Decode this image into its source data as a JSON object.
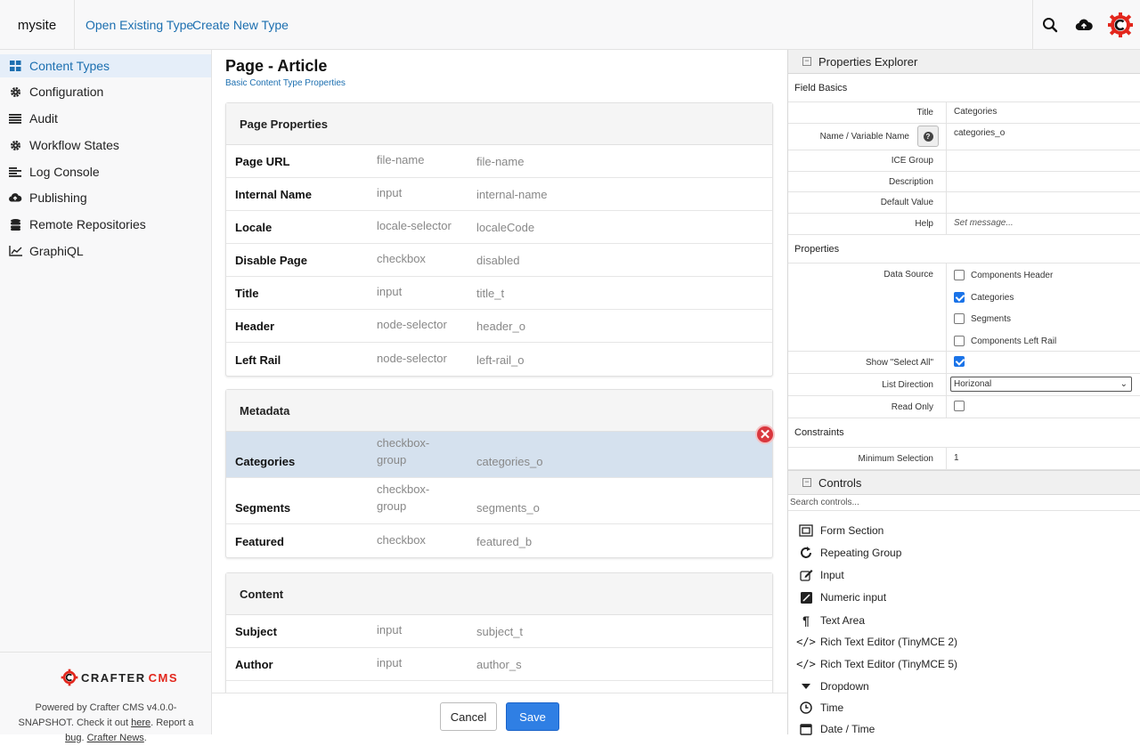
{
  "topbar": {
    "site": "mysite",
    "open_existing": "Open Existing Type",
    "create_new": "Create New Type"
  },
  "sidebar": {
    "items": [
      {
        "label": "Content Types",
        "icon": "grid-icon"
      },
      {
        "label": "Configuration",
        "icon": "gear-icon"
      },
      {
        "label": "Audit",
        "icon": "list-icon"
      },
      {
        "label": "Workflow States",
        "icon": "gear-icon"
      },
      {
        "label": "Log Console",
        "icon": "log-icon"
      },
      {
        "label": "Publishing",
        "icon": "cloud-upload-icon"
      },
      {
        "label": "Remote Repositories",
        "icon": "database-icon"
      },
      {
        "label": "GraphiQL",
        "icon": "chart-icon"
      }
    ],
    "footer": {
      "logo_crafter": "CRAFTER",
      "logo_cms": "CMS",
      "powered": "Powered by Crafter CMS v4.0.0-SNAPSHOT. Check it out ",
      "here": "here",
      "report": ". Report a ",
      "bug": "bug",
      "sep": ". ",
      "news": "Crafter News",
      "end": "."
    }
  },
  "main": {
    "title": "Page - Article",
    "subtitle": "Basic Content Type Properties",
    "sections": [
      {
        "title": "Page Properties",
        "rows": [
          {
            "name": "Page URL",
            "type": "file-name",
            "var": "file-name"
          },
          {
            "name": "Internal Name",
            "type": "input",
            "var": "internal-name"
          },
          {
            "name": "Locale",
            "type": "locale-selector",
            "var": "localeCode"
          },
          {
            "name": "Disable Page",
            "type": "checkbox",
            "var": "disabled"
          },
          {
            "name": "Title",
            "type": "input",
            "var": "title_t"
          },
          {
            "name": "Header",
            "type": "node-selector",
            "var": "header_o"
          },
          {
            "name": "Left Rail",
            "type": "node-selector",
            "var": "left-rail_o"
          }
        ]
      },
      {
        "title": "Metadata",
        "rows": [
          {
            "name": "Categories",
            "type": "checkbox-group",
            "var": "categories_o"
          },
          {
            "name": "Segments",
            "type": "checkbox-group",
            "var": "segments_o"
          },
          {
            "name": "Featured",
            "type": "checkbox",
            "var": "featured_b"
          }
        ]
      },
      {
        "title": "Content",
        "rows": [
          {
            "name": "Subject",
            "type": "input",
            "var": "subject_t"
          },
          {
            "name": "Author",
            "type": "input",
            "var": "author_s"
          }
        ]
      }
    ],
    "cancel": "Cancel",
    "save": "Save"
  },
  "properties": {
    "header": "Properties Explorer",
    "field_basics": "Field Basics",
    "title_label": "Title",
    "title_value": "Categories",
    "name_label": "Name / Variable Name",
    "name_value": "categories_o",
    "ice_label": "ICE Group",
    "desc_label": "Description",
    "default_label": "Default Value",
    "help_label": "Help",
    "help_placeholder": "Set message...",
    "properties_section": "Properties",
    "datasource_label": "Data Source",
    "datasources": [
      {
        "label": "Components Header",
        "checked": false
      },
      {
        "label": "Categories",
        "checked": true
      },
      {
        "label": "Segments",
        "checked": false
      },
      {
        "label": "Components Left Rail",
        "checked": false
      }
    ],
    "selectall_label": "Show \"Select All\"",
    "selectall_checked": true,
    "direction_label": "List Direction",
    "direction_value": "Horizonal",
    "readonly_label": "Read Only",
    "readonly_checked": false,
    "constraints_section": "Constraints",
    "minsel_label": "Minimum Selection",
    "minsel_value": "1"
  },
  "controls": {
    "header": "Controls",
    "search_placeholder": "Search controls...",
    "items": [
      {
        "label": "Form Section",
        "icon": "form-section-icon"
      },
      {
        "label": "Repeating Group",
        "icon": "repeat-icon"
      },
      {
        "label": "Input",
        "icon": "edit-icon"
      },
      {
        "label": "Numeric input",
        "icon": "numeric-icon"
      },
      {
        "label": "Text Area",
        "icon": "paragraph-icon"
      },
      {
        "label": "Rich Text Editor (TinyMCE 2)",
        "icon": "code-icon"
      },
      {
        "label": "Rich Text Editor (TinyMCE 5)",
        "icon": "code-icon"
      },
      {
        "label": "Dropdown",
        "icon": "caret-down-icon"
      },
      {
        "label": "Time",
        "icon": "clock-icon"
      },
      {
        "label": "Date / Time",
        "icon": "calendar-icon"
      }
    ]
  }
}
